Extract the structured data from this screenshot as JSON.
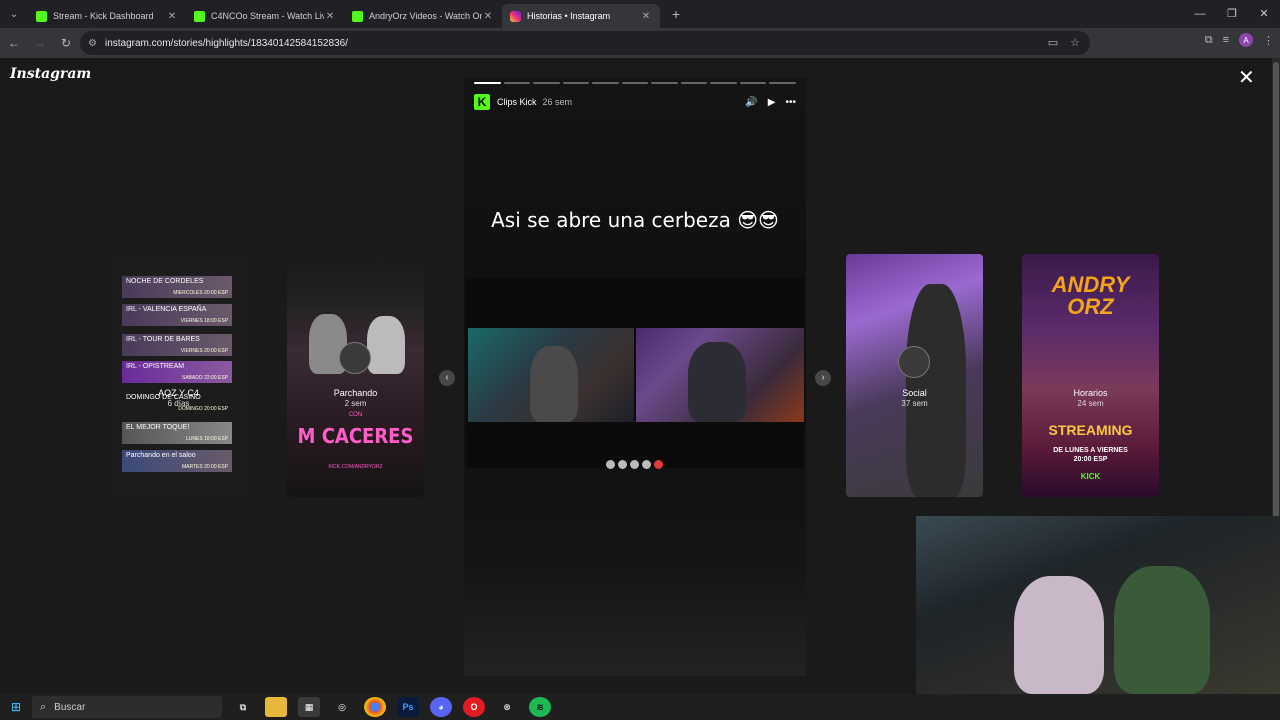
{
  "browser": {
    "tabs": [
      {
        "title": "Stream - Kick Dashboard",
        "favicon": "kick",
        "active": false
      },
      {
        "title": "C4NCOo Stream - Watch Live o",
        "favicon": "kick",
        "active": false
      },
      {
        "title": "AndryOrz Videos - Watch On-D",
        "favicon": "kick",
        "active": false
      },
      {
        "title": "Historias • Instagram",
        "favicon": "instagram",
        "active": true
      }
    ],
    "url": "instagram.com/stories/highlights/18340142584152836/"
  },
  "page": {
    "logo": "Instagram",
    "story": {
      "username": "Clips Kick",
      "age": "26 sem",
      "caption": "Asi se abre una cerbeza 😎😎",
      "segments_total": 11,
      "segments_done": 1
    },
    "highlights_left": [
      {
        "name": "AOZ Y C4",
        "age": "6 días",
        "rows": [
          {
            "title": "NOCHE DE CORDELES",
            "day": "MIERCOLES 20:00 ESP"
          },
          {
            "title": "IRL - VALENCIA ESPAÑA",
            "day": "VIERNES 18:00 ESP"
          },
          {
            "title": "IRL - TOUR DE BARES",
            "day": "VIERNES 20:00 ESP"
          },
          {
            "title": "IRL - OPISTREAM",
            "day": "SABADO 22:00 ESP"
          },
          {
            "title": "DOMINGO DE CASINO",
            "day": "DOMINGO 20:00 ESP"
          },
          {
            "title": "EL MEJOR TOQUE!",
            "day": "LUNES 18:00 ESP"
          },
          {
            "title": "Parchando en el saloo",
            "day": "MARTES 20:00 ESP"
          }
        ]
      },
      {
        "name": "Parchando",
        "age": "2 sem",
        "banner": "M CACERES",
        "banner_small": "CON",
        "footer": "KICK.COM/ANDRYORZ"
      }
    ],
    "highlights_right": [
      {
        "name": "Social",
        "age": "37 sem"
      },
      {
        "name": "Horarios",
        "age": "24 sem",
        "logo_line1": "ANDRY",
        "logo_line2": "ORZ",
        "headline": "STREAMING",
        "days_line1": "DE LUNES A VIERNES",
        "days_line2": "20:00 ESP",
        "brand": "KICK"
      }
    ]
  },
  "taskbar": {
    "search_placeholder": "Buscar"
  },
  "colors": {
    "kick_green": "#53fc18",
    "parchando_pink": "#ff5ec8",
    "streaming_yellow": "#f9c93c"
  }
}
